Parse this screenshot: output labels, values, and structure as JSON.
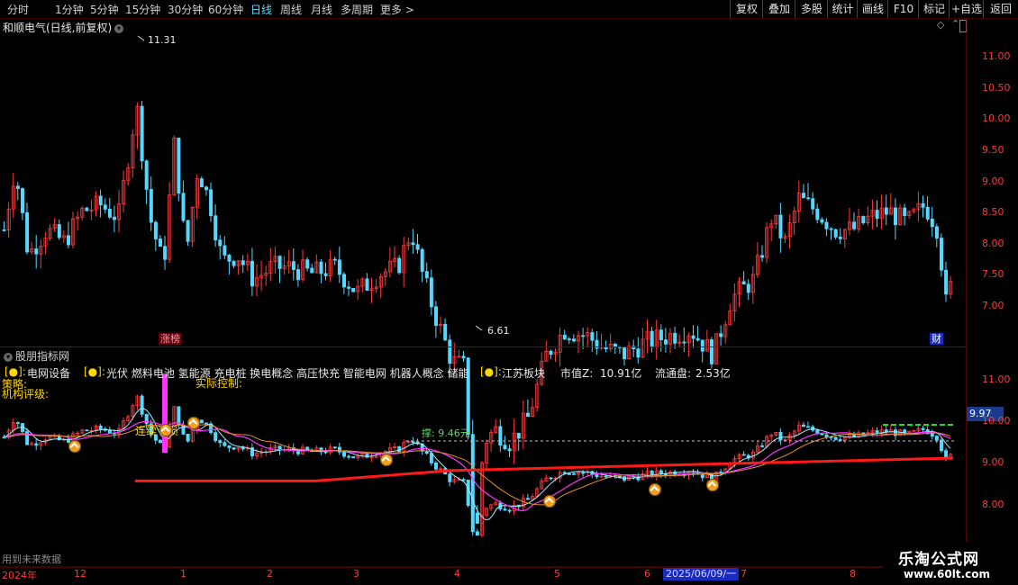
{
  "toolbar": {
    "timeframes": [
      "分时",
      "1分钟",
      "5分钟",
      "15分钟",
      "30分钟",
      "60分钟",
      "日线",
      "周线",
      "月线",
      "多周期",
      "更多 >"
    ],
    "active": "日线",
    "buttons": [
      "复权",
      "叠加",
      "多股",
      "统计",
      "画线",
      "F10",
      "标记",
      "+自选",
      "返回"
    ]
  },
  "main": {
    "title": "和顺电气(日线,前复权)",
    "high_label": "11.31",
    "low_label": "6.61",
    "zt_tag": "涨榜",
    "cai_tag": "财",
    "y_ticks": [
      "11.00",
      "10.50",
      "10.00",
      "9.50",
      "9.00",
      "8.50",
      "8.00",
      "7.50",
      "7.00"
    ]
  },
  "indicator": {
    "title": "股朋指标网",
    "line1": [
      {
        "k": "[●]:",
        "v": "电网设备"
      },
      {
        "k": "[●]:",
        "v": "光伏 燃料电池 氢能源 充电桩 换电概念 高压快充 智能电网 机器人概念 储能"
      },
      {
        "k": "[●]:",
        "v": "江苏板块"
      }
    ],
    "mktcap_label": "市值Z:",
    "mktcap": "10.91亿",
    "float_label": "流通盘:",
    "float": "2.53亿",
    "strategy": "策略:",
    "rating": "机构评级:",
    "control": "实际控制:",
    "support": "撑: 9.46元",
    "loss": "连续亏损",
    "price_tag": "9.97",
    "y_ticks": [
      "11.00",
      "10.00",
      "9.00",
      "8.00"
    ],
    "no_future": "用到未来数据"
  },
  "dates": {
    "labels": [
      "2024年",
      "12",
      "1",
      "2",
      "3",
      "4",
      "5",
      "6",
      "7",
      "8"
    ],
    "selected": "2025/06/09/一"
  },
  "watermark": {
    "name": "乐淘公式网",
    "url": "www.60lt.com"
  },
  "colors": {
    "up": "#ff3a3a",
    "down": "#54d8ff",
    "ma_red": "#ff1a1a",
    "ma_magenta": "#ff33ff",
    "ma_cyan": "#9ff0ff",
    "ma_orange": "#e09030",
    "accent": "#ffd700"
  }
}
